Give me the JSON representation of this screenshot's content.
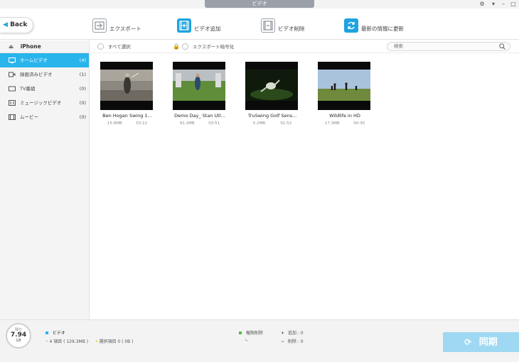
{
  "window": {
    "title": "ビデオ"
  },
  "toolbar": {
    "back_label": "Back",
    "export_label": "エクスポート",
    "add_label": "ビデオ追加",
    "delete_label": "ビデオ削除",
    "refresh_label": "最新の情報に更新"
  },
  "sidebar": {
    "device": "iPhone",
    "items": [
      {
        "label": "ホームビデオ",
        "count": "(4)"
      },
      {
        "label": "録画済みビデオ",
        "count": "(1)"
      },
      {
        "label": "TV番組",
        "count": "(0)"
      },
      {
        "label": "ミュージックビデオ",
        "count": "(0)"
      },
      {
        "label": "ムービー",
        "count": "(0)"
      }
    ]
  },
  "filter": {
    "select_all": "すべて選択",
    "encrypt": "エクスポート暗号化",
    "search_placeholder": "検索"
  },
  "videos": [
    {
      "title": "Ben Hogan Swing 1...",
      "size": "15.6MB",
      "duration": "03:12"
    },
    {
      "title": "Demo Day_ Stan Utl...",
      "size": "91.2MB",
      "duration": "03:51"
    },
    {
      "title": "TruSwing Golf Sens...",
      "size": "5.2MB",
      "duration": "01:52"
    },
    {
      "title": "Wildlife in HD",
      "size": "17.3MB",
      "duration": "00:30"
    }
  ],
  "status": {
    "storage_label": "残り",
    "storage_value": "7.94",
    "storage_unit": "GB",
    "category": "ビデオ",
    "items_text": "4 項目 ( 129.3MB )",
    "selected_text": "選択項目 0 ( 0B )",
    "deleted_label": "権限削除",
    "add_text": "追加 : 0",
    "remove_text": "削除 : 0",
    "sync_label": "同期"
  },
  "colors": {
    "accent": "#2ab4ec",
    "sync": "#9fd8f2"
  }
}
